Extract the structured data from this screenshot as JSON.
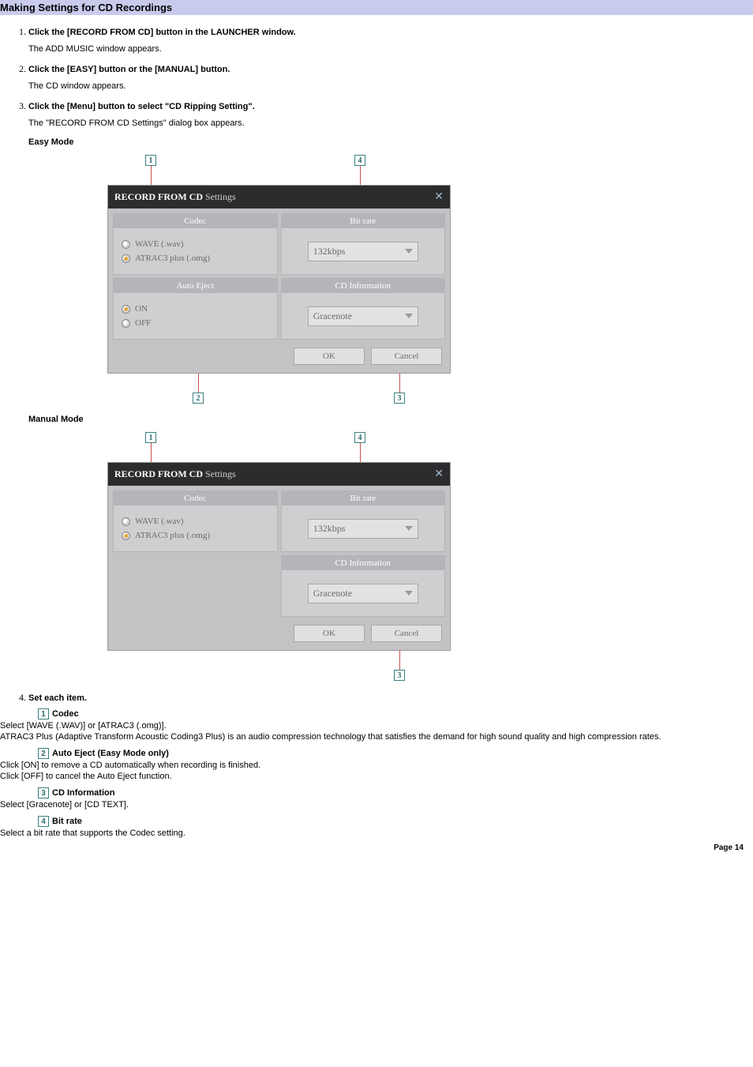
{
  "pageTitle": "Making Settings for CD Recordings",
  "steps": {
    "s1": {
      "strong": "Click the [RECORD FROM CD] button in the LAUNCHER window.",
      "body": "The ADD MUSIC window appears."
    },
    "s2": {
      "strong": "Click the [EASY] button or the [MANUAL] button.",
      "body": "The CD window appears."
    },
    "s3": {
      "strong": "Click the [Menu] button to select \"CD Ripping Setting\".",
      "body": "The \"RECORD FROM CD Settings\" dialog box appears."
    },
    "s4": {
      "strong": "Set each item."
    }
  },
  "modeHeadings": {
    "easy": "Easy Mode",
    "manual": "Manual Mode"
  },
  "callouts": {
    "n1": "1",
    "n2": "2",
    "n3": "3",
    "n4": "4"
  },
  "dialog": {
    "titleStrong": "RECORD FROM CD",
    "titleLight": "Settings",
    "close": "✕",
    "panels": {
      "codec": "Codec",
      "bitrate": "Bit rate",
      "autoEject": "Auto Eject",
      "cdInfo": "CD Information"
    },
    "codecOptions": {
      "wave": "WAVE (.wav)",
      "atrac": "ATRAC3 plus (.omg)"
    },
    "bitrateValue": "132kbps",
    "autoEjectOptions": {
      "on": "ON",
      "off": "OFF"
    },
    "cdInfoValue": "Gracenote",
    "buttons": {
      "ok": "OK",
      "cancel": "Cancel"
    }
  },
  "items": {
    "codec": {
      "num": "1",
      "title": "Codec",
      "line1": "Select [WAVE (.WAV)] or [ATRAC3 (.omg)].",
      "line2": "ATRAC3 Plus (Adaptive Transform Acoustic Coding3 Plus) is an audio compression technology that satisfies the demand for high sound quality and high compression rates."
    },
    "autoEject": {
      "num": "2",
      "title": "Auto Eject (Easy Mode only)",
      "line1": "Click [ON] to remove a CD automatically when recording is finished.",
      "line2": "Click [OFF] to cancel the Auto Eject function."
    },
    "cdInfo": {
      "num": "3",
      "title": "CD Information",
      "line1": "Select [Gracenote] or [CD TEXT]."
    },
    "bitrate": {
      "num": "4",
      "title": "Bit rate",
      "line1": "Select a bit rate that supports the Codec setting."
    }
  },
  "pageNumber": "Page 14"
}
